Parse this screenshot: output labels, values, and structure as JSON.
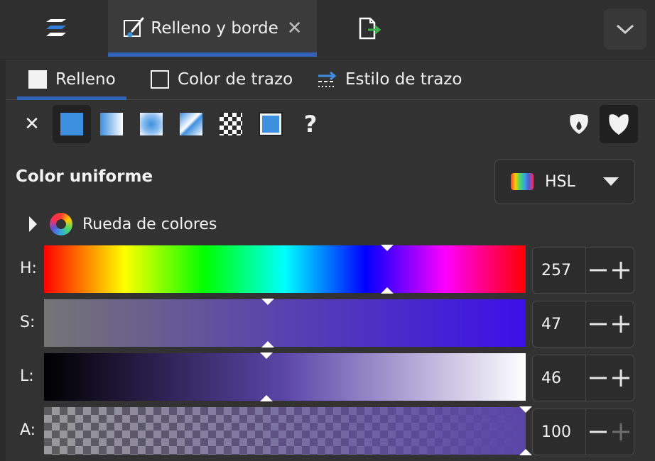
{
  "dock_tabs": {
    "fill_stroke_label": "Relleno y borde",
    "close_glyph": "✕"
  },
  "sub_tabs": {
    "fill": "Relleno",
    "stroke_paint": "Color de trazo",
    "stroke_style": "Estilo de trazo"
  },
  "paint_modes": {
    "none_glyph": "✕",
    "unset_glyph": "?"
  },
  "section": {
    "title": "Color uniforme",
    "color_model": "HSL"
  },
  "color_wheel": {
    "label": "Rueda de colores"
  },
  "sliders": [
    {
      "label": "H:",
      "value": "257",
      "fraction": 0.713
    },
    {
      "label": "S:",
      "value": "47",
      "fraction": 0.465
    },
    {
      "label": "L:",
      "value": "46",
      "fraction": 0.462
    },
    {
      "label": "A:",
      "value": "100",
      "fraction": 1.0
    }
  ],
  "colors": {
    "accent": "#2f62b8",
    "current": "#5b46a8",
    "flat_fill": "#3d8fe0"
  }
}
